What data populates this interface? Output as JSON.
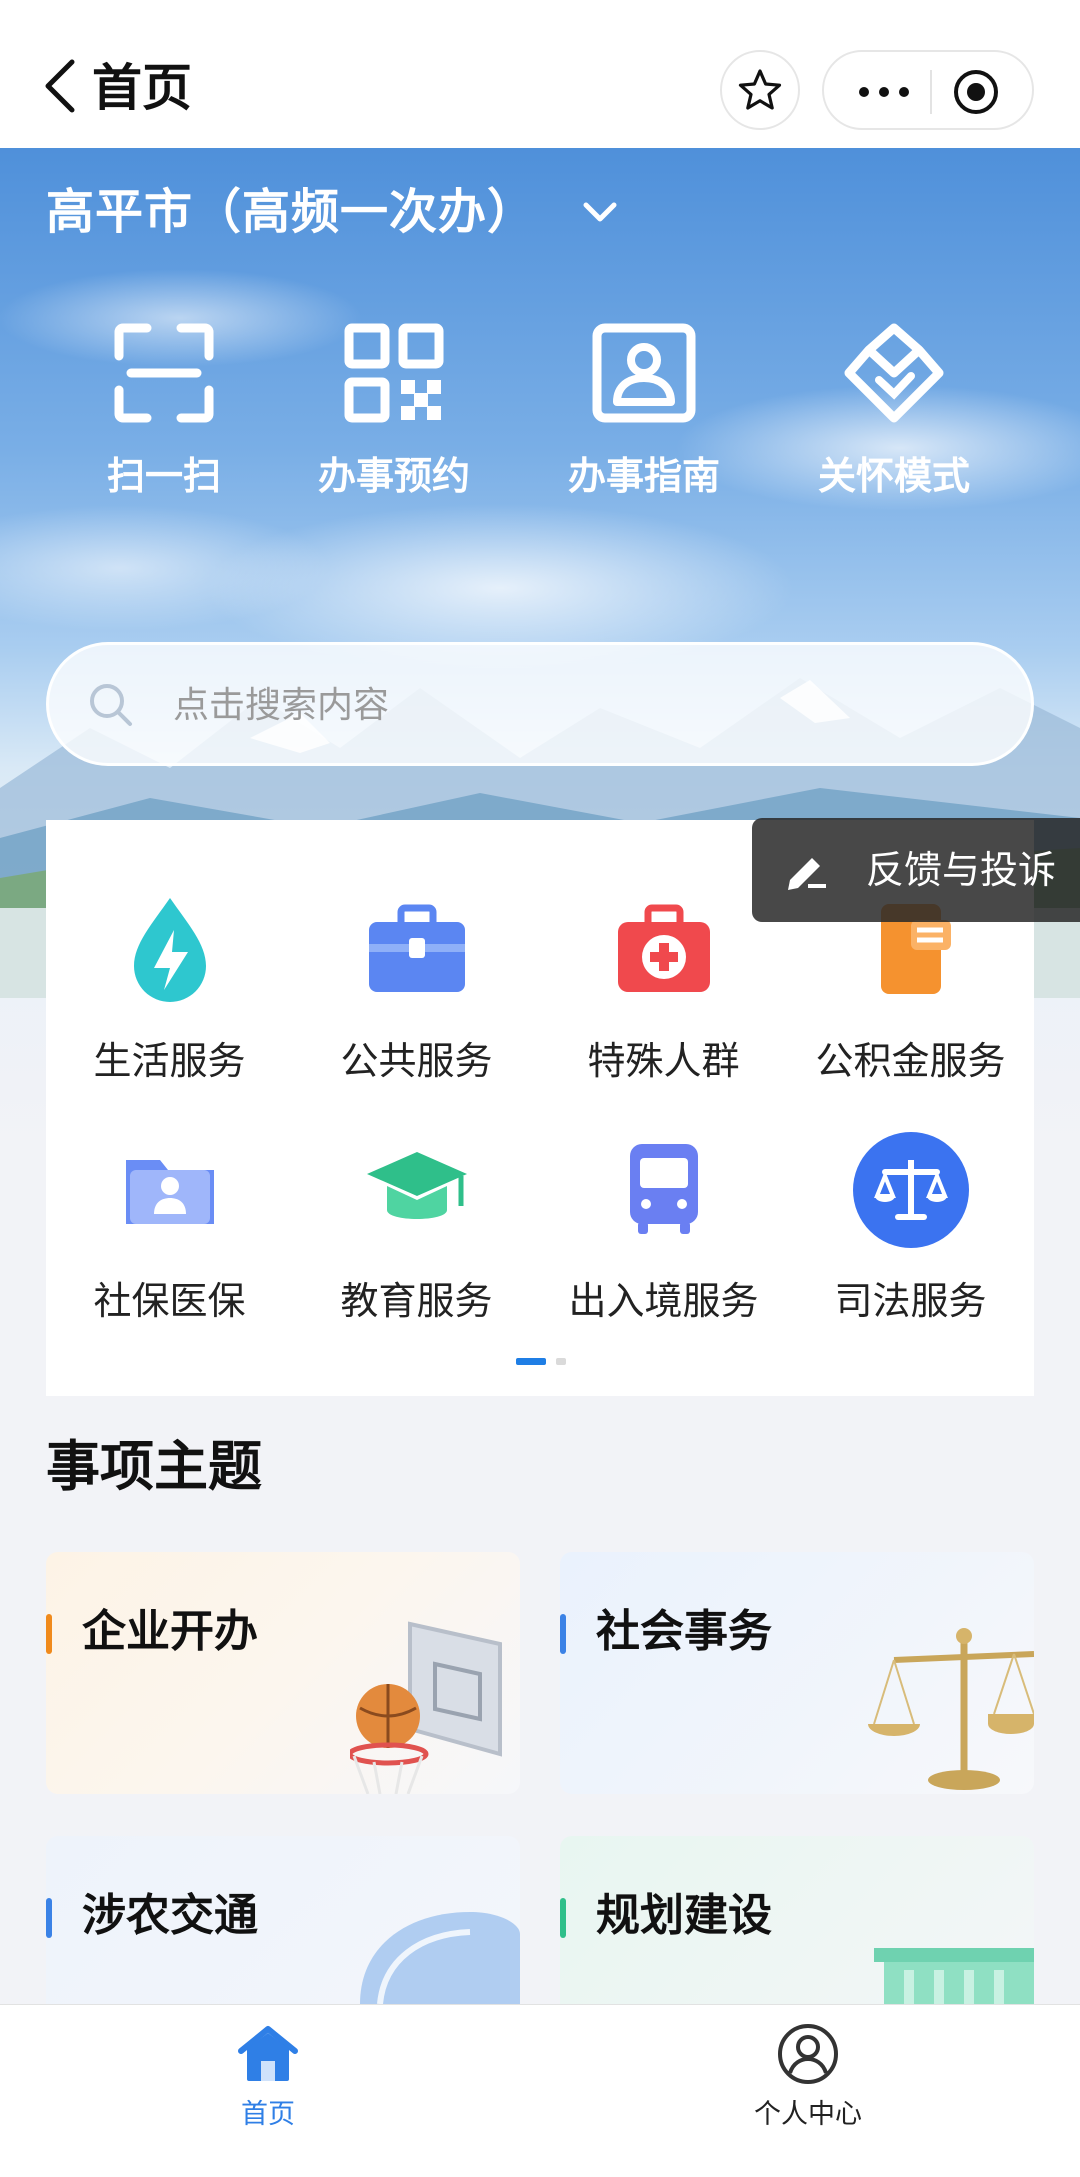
{
  "nav": {
    "back_icon": "chevron-left-icon",
    "title": "首页",
    "favorite_icon": "star-icon",
    "more_icon": "more-dots-icon",
    "close_icon": "target-icon"
  },
  "hero": {
    "city": "高平市（高频一次办）",
    "city_dropdown_icon": "chevron-down-icon",
    "quick_actions": [
      {
        "label": "扫一扫",
        "icon": "scan-icon"
      },
      {
        "label": "办事预约",
        "icon": "qr-code-icon"
      },
      {
        "label": "办事指南",
        "icon": "id-card-icon"
      },
      {
        "label": "关怀模式",
        "icon": "care-heart-icon"
      }
    ],
    "search_placeholder": "点击搜索内容"
  },
  "feedback": {
    "label": "反馈与投诉",
    "icon": "edit-icon"
  },
  "services": {
    "items": [
      {
        "label": "生活服务",
        "icon": "lightning-drop-icon",
        "color": "#2ec7cf"
      },
      {
        "label": "公共服务",
        "icon": "briefcase-icon",
        "color": "#5b86f2"
      },
      {
        "label": "特殊人群",
        "icon": "medical-kit-icon",
        "color": "#f0494d"
      },
      {
        "label": "公积金服务",
        "icon": "fund-book-icon",
        "color": "#f5922f"
      },
      {
        "label": "社保医保",
        "icon": "person-folder-icon",
        "color": "#6a8df5"
      },
      {
        "label": "教育服务",
        "icon": "graduation-cap-icon",
        "color": "#2fbf8a"
      },
      {
        "label": "出入境服务",
        "icon": "bus-icon",
        "color": "#6a7ff2"
      },
      {
        "label": "司法服务",
        "icon": "scales-icon",
        "color": "#3b73f0"
      }
    ],
    "page_indicator": {
      "current": 1,
      "total": 2
    }
  },
  "themes": {
    "title": "事项主题",
    "items": [
      {
        "label": "企业开办",
        "accent": "#f08a1c",
        "icon": "basketball-hoop-icon"
      },
      {
        "label": "社会事务",
        "accent": "#3b82e6",
        "icon": "scales-icon"
      },
      {
        "label": "涉农交通",
        "accent": "#3b82e6",
        "icon": "helmet-icon"
      },
      {
        "label": "规划建设",
        "accent": "#2fbf8a",
        "icon": "building-icon"
      }
    ]
  },
  "tabbar": {
    "items": [
      {
        "label": "首页",
        "icon": "home-icon",
        "active": true,
        "color": "#2f7fe6"
      },
      {
        "label": "个人中心",
        "icon": "user-circle-icon",
        "active": false,
        "color": "#222222"
      }
    ]
  }
}
